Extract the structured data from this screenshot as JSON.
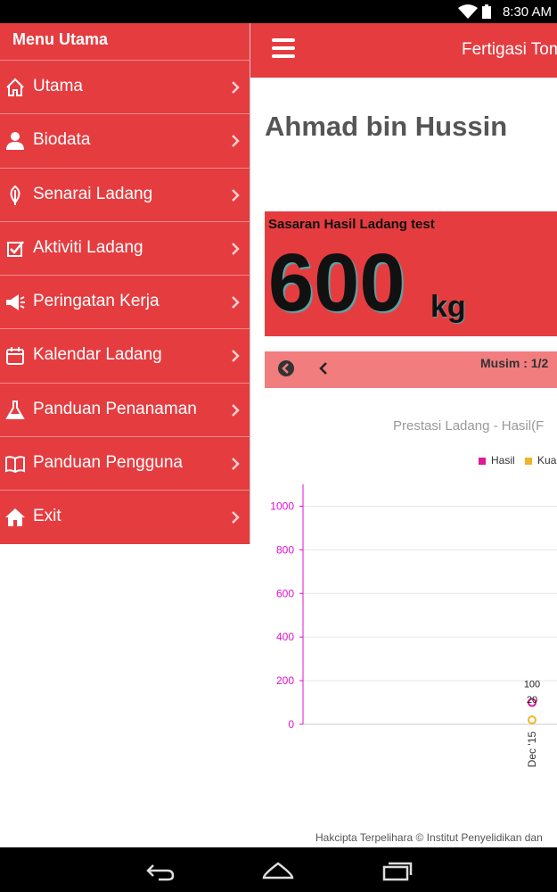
{
  "status_bar": {
    "time": "8:30 AM"
  },
  "app_bar": {
    "title": "Fertigasi Tomato"
  },
  "drawer": {
    "title": "Menu Utama",
    "items": [
      {
        "label": "Utama",
        "icon": "home-outline-icon"
      },
      {
        "label": "Biodata",
        "icon": "user-icon"
      },
      {
        "label": "Senarai Ladang",
        "icon": "leaf-icon"
      },
      {
        "label": "Aktiviti Ladang",
        "icon": "checkbox-icon"
      },
      {
        "label": "Peringatan Kerja",
        "icon": "megaphone-icon"
      },
      {
        "label": "Kalendar Ladang",
        "icon": "calendar-icon"
      },
      {
        "label": "Panduan Penanaman",
        "icon": "flask-icon"
      },
      {
        "label": "Panduan Pengguna",
        "icon": "open-book-icon"
      },
      {
        "label": "Exit",
        "icon": "home-solid-icon"
      }
    ]
  },
  "profile": {
    "name": "Ahmad bin Hussin"
  },
  "target": {
    "label": "Sasaran Hasil Ladang test",
    "value": "600",
    "unit": "kg"
  },
  "season": {
    "label": "Musim : 1/2"
  },
  "chart_data": {
    "type": "scatter",
    "title": "Prestasi Ladang - Hasil(F",
    "legend": [
      "Hasil",
      "Kua"
    ],
    "legend_position": "top",
    "colors": {
      "Hasil": "#e0189a",
      "Kua": "#f0b429"
    },
    "y_ticks": [
      "0",
      "200",
      "400",
      "600",
      "800",
      "1000"
    ],
    "ylim": [
      0,
      1100
    ],
    "categories": [
      "Dec '15"
    ],
    "series": [
      {
        "name": "Hasil",
        "values": [
          100
        ],
        "labels": [
          "100"
        ]
      },
      {
        "name": "Kua",
        "values": [
          20
        ],
        "labels": [
          "20"
        ]
      }
    ],
    "grid": true
  },
  "footer": {
    "text": "Hakcipta Terpelihara © Institut Penyelidikan dan"
  },
  "colors": {
    "primary": "#e53c40",
    "season_bar": "#f17d7f",
    "axis": "#e010d0"
  }
}
